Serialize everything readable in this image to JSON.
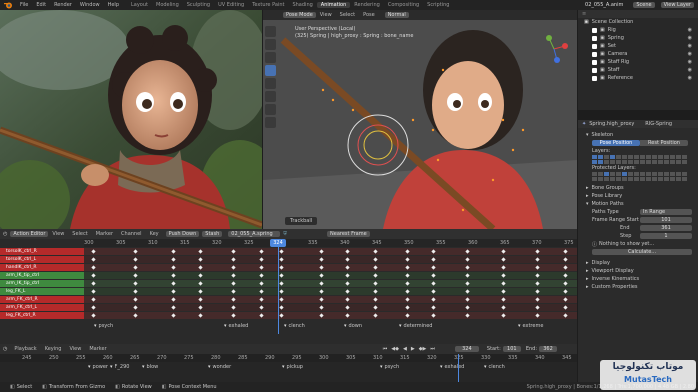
{
  "topbar": {
    "menus": [
      "File",
      "Edit",
      "Render",
      "Window",
      "Help"
    ],
    "workspaces": [
      "Layout",
      "Modeling",
      "Sculpting",
      "UV Editing",
      "Texture Paint",
      "Shading",
      "Animation",
      "Rendering",
      "Compositing",
      "Scripting"
    ],
    "active_workspace": "Animation",
    "file_name": "02_055_A.anim",
    "scene_label": "Scene",
    "view_layer": "View Layer"
  },
  "viewport": {
    "mode": "Pose Mode",
    "menus": [
      "View",
      "Select",
      "Pose"
    ],
    "orientation": "Normal",
    "info_line1": "User Perspective (Local)",
    "info_line2": "(325) Spring | high_proxy : Spring : bone_name",
    "tool_label": "Trackball"
  },
  "outliner": {
    "title": "Scene Collection",
    "items": [
      "Rig",
      "Spring",
      "Set",
      "Camera",
      "Staff Rig",
      "Staff",
      "Reference"
    ]
  },
  "properties": {
    "object_name": "Spring.high_proxy",
    "rig_label": "RIG-Spring",
    "section": "Skeleton",
    "pose_position": "Pose Position",
    "rest_position": "Rest Position",
    "layers_label": "Layers:",
    "protected_label": "Protected Layers:",
    "subpanels": [
      "Bone Groups",
      "Pose Library",
      "Motion Paths"
    ],
    "paths_type_label": "Paths Type",
    "paths_type_value": "In Range",
    "frame_start_label": "Frame Range Start",
    "frame_start_value": "101",
    "end_label": "End",
    "end_value": "361",
    "step_label": "Step",
    "step_value": "1",
    "nothing_label": "Nothing to show yet...",
    "calculate_label": "Calculate...",
    "more_panels": [
      "Display",
      "Viewport Display",
      "Inverse Kinematics",
      "Custom Properties"
    ]
  },
  "dopesheet": {
    "editor": "Action Editor",
    "menus": [
      "View",
      "Select",
      "Marker",
      "Channel",
      "Key"
    ],
    "push_down": "Push Down",
    "stash": "Stash",
    "action_name": "02_055_A.spring",
    "nearest_frame": "Nearest Frame",
    "ruler": [
      "300",
      "305",
      "310",
      "315",
      "320",
      "325",
      "330",
      "335",
      "340",
      "345",
      "350",
      "355",
      "360",
      "365",
      "370",
      "375"
    ],
    "channels": [
      "torsoIK_ctrl_R",
      "torsoIK_ctrl_L",
      "handIK_ctrl_R",
      "arm_IK_tip_ctrl",
      "arm_IK_tip_ctrl",
      "leg_FK_L",
      "arm_FK_ctrl_R",
      "arm_FK_ctrl_L",
      "leg_FK_ctrl_R",
      "Master_Foot_ctrl",
      "Subsidy_shoulder_L",
      "Subsidy_shoulder_R",
      "thigh_FK_ctrl",
      "Subsidy_Foot_L",
      "Subsidy_Foot_R"
    ],
    "markers": [
      "psych",
      "exhaled",
      "clench",
      "down",
      "determined",
      "extreme"
    ]
  },
  "timeline": {
    "menus": [
      "Playback",
      "Keying",
      "View",
      "Marker"
    ],
    "current_frame": "324",
    "start_label": "Start:",
    "start_value": "101",
    "end_label": "End:",
    "end_value": "362",
    "ruler": [
      "245",
      "250",
      "255",
      "260",
      "265",
      "270",
      "275",
      "280",
      "285",
      "290",
      "295",
      "300",
      "305",
      "310",
      "315",
      "320",
      "325",
      "330",
      "335",
      "340",
      "345"
    ],
    "markers": [
      "power",
      "F_290",
      "blow",
      "wonder",
      "pickup",
      "psych",
      "exhaled",
      "clench"
    ]
  },
  "statusbar": {
    "items": [
      "Select",
      "Transform From Gizmo",
      "Rotate View",
      "Pose Context Menu"
    ],
    "stats": "Spring.high_proxy | Bones:1/1,268 | Tris:1,700,000 | 4.48 GB | 2.80",
    "watermark_ar": "موتاب تكنولوجيا",
    "watermark_en": "MutasTech"
  },
  "colors": {
    "accent": "#4772b3",
    "keyframe_red": "#c03030",
    "keyframe_green": "#3f8a3f",
    "playhead": "#4d88e0",
    "marker_active": "#e4e4e4"
  }
}
